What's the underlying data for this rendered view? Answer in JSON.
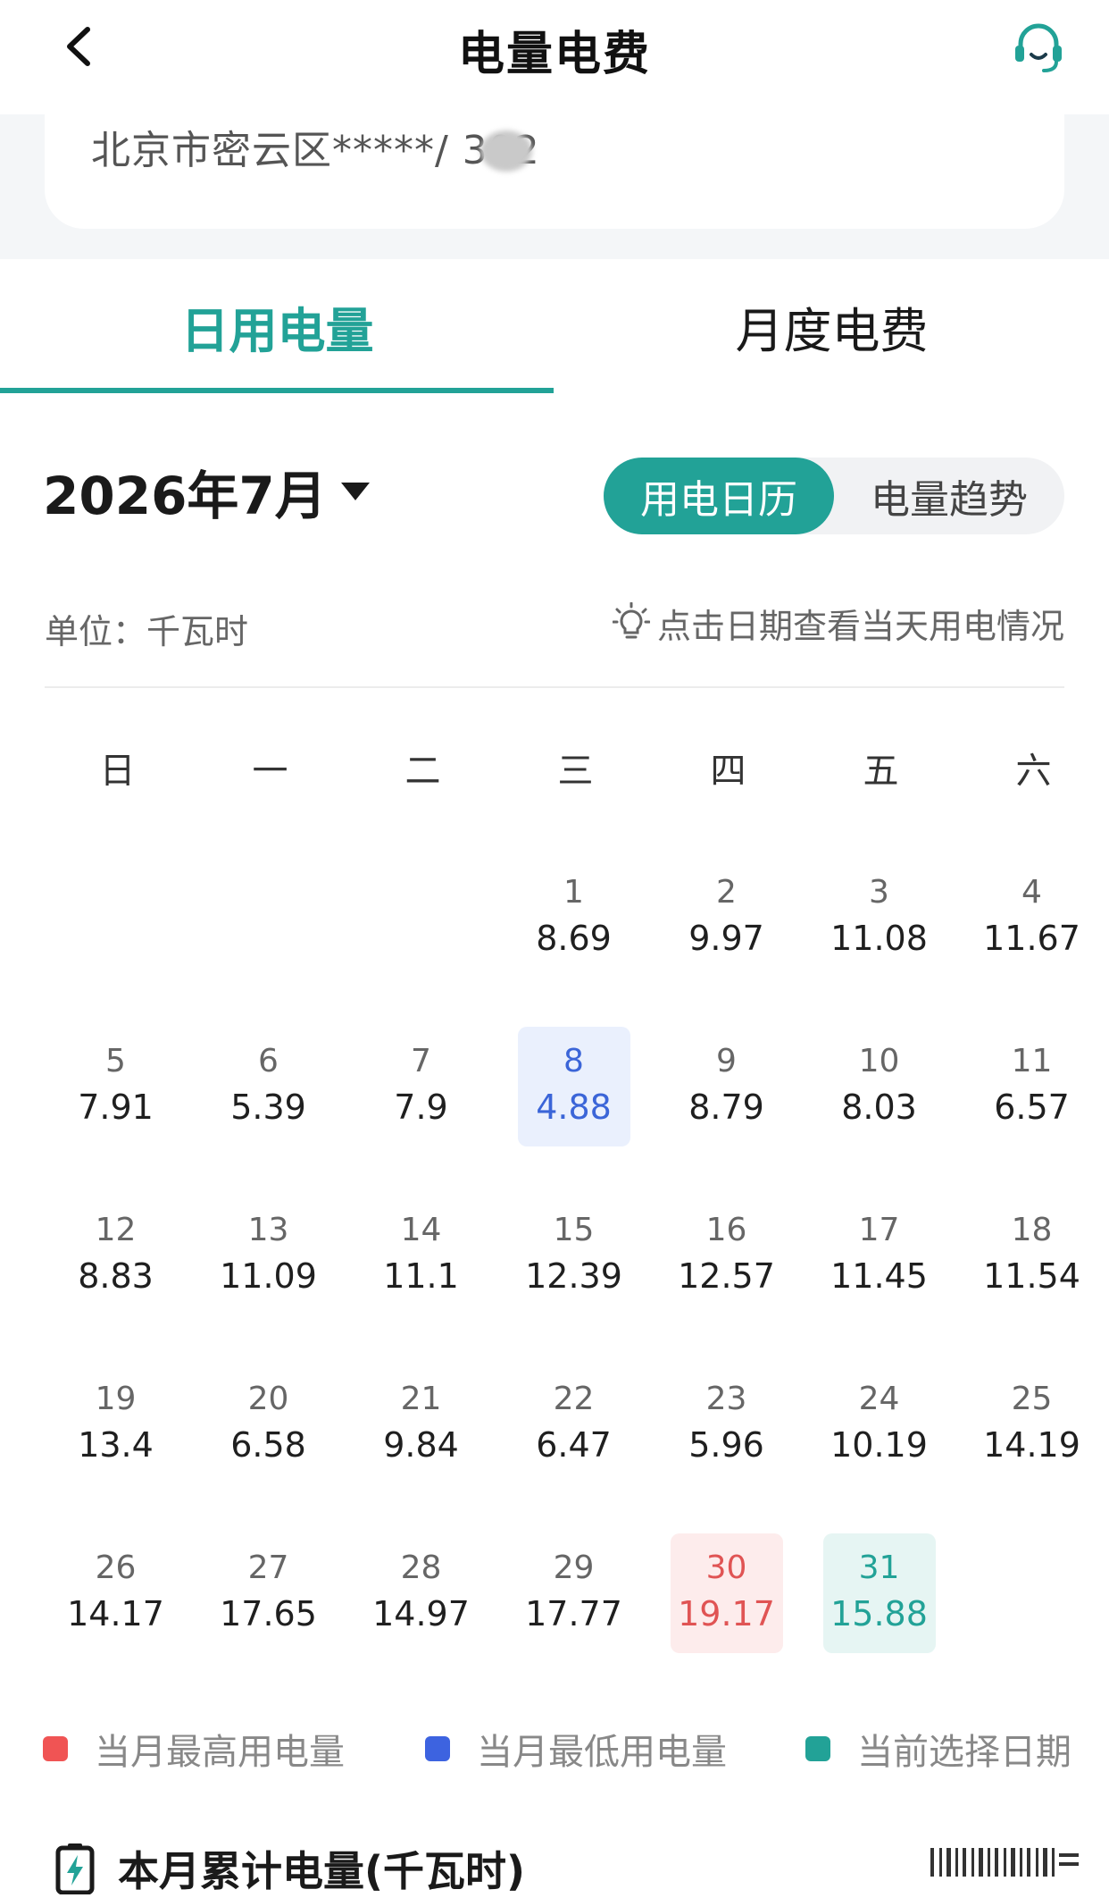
{
  "header": {
    "title": "电量电费"
  },
  "address": {
    "text": "北京市密云区*****/    302"
  },
  "tabs": [
    {
      "label": "日用电量",
      "active": true
    },
    {
      "label": "月度电费",
      "active": false
    }
  ],
  "month_selector": {
    "label": "2026年7月"
  },
  "view_toggle": {
    "calendar_label": "用电日历",
    "trend_label": "电量趋势",
    "selected": "用电日历"
  },
  "unit": {
    "label": "单位：千瓦时"
  },
  "hint": {
    "text": "点击日期查看当天用电情况"
  },
  "calendar": {
    "weekdays": [
      "日",
      "一",
      "二",
      "三",
      "四",
      "五",
      "六"
    ],
    "first_weekday_index": 3,
    "days": [
      {
        "day": "1",
        "kwh": "8.69"
      },
      {
        "day": "2",
        "kwh": "9.97"
      },
      {
        "day": "3",
        "kwh": "11.08"
      },
      {
        "day": "4",
        "kwh": "11.67"
      },
      {
        "day": "5",
        "kwh": "7.91"
      },
      {
        "day": "6",
        "kwh": "5.39"
      },
      {
        "day": "7",
        "kwh": "7.9"
      },
      {
        "day": "8",
        "kwh": "4.88",
        "status": "low"
      },
      {
        "day": "9",
        "kwh": "8.79"
      },
      {
        "day": "10",
        "kwh": "8.03"
      },
      {
        "day": "11",
        "kwh": "6.57"
      },
      {
        "day": "12",
        "kwh": "8.83"
      },
      {
        "day": "13",
        "kwh": "11.09"
      },
      {
        "day": "14",
        "kwh": "11.1"
      },
      {
        "day": "15",
        "kwh": "12.39"
      },
      {
        "day": "16",
        "kwh": "12.57"
      },
      {
        "day": "17",
        "kwh": "11.45"
      },
      {
        "day": "18",
        "kwh": "11.54"
      },
      {
        "day": "19",
        "kwh": "13.4"
      },
      {
        "day": "20",
        "kwh": "6.58"
      },
      {
        "day": "21",
        "kwh": "9.84"
      },
      {
        "day": "22",
        "kwh": "6.47"
      },
      {
        "day": "23",
        "kwh": "5.96"
      },
      {
        "day": "24",
        "kwh": "10.19"
      },
      {
        "day": "25",
        "kwh": "14.19"
      },
      {
        "day": "26",
        "kwh": "14.17"
      },
      {
        "day": "27",
        "kwh": "17.65"
      },
      {
        "day": "28",
        "kwh": "14.97"
      },
      {
        "day": "29",
        "kwh": "17.77"
      },
      {
        "day": "30",
        "kwh": "19.17",
        "status": "high"
      },
      {
        "day": "31",
        "kwh": "15.88",
        "status": "selected"
      }
    ]
  },
  "legend": [
    {
      "label": "当月最高用电量",
      "color": "#f05454"
    },
    {
      "label": "当月最低用电量",
      "color": "#3d63e0"
    },
    {
      "label": "当前选择日期",
      "color": "#22a297"
    }
  ],
  "cumulative": {
    "title": "本月累计电量(千瓦时)"
  },
  "colors": {
    "accent": "#22a297",
    "high": "#e05454",
    "low": "#3b65d8"
  },
  "icons": {
    "back": "chevron-left-icon",
    "service": "headset-icon",
    "hint": "lightbulb-icon",
    "caret": "caret-down-icon",
    "cumulative": "battery-bolt-icon"
  }
}
